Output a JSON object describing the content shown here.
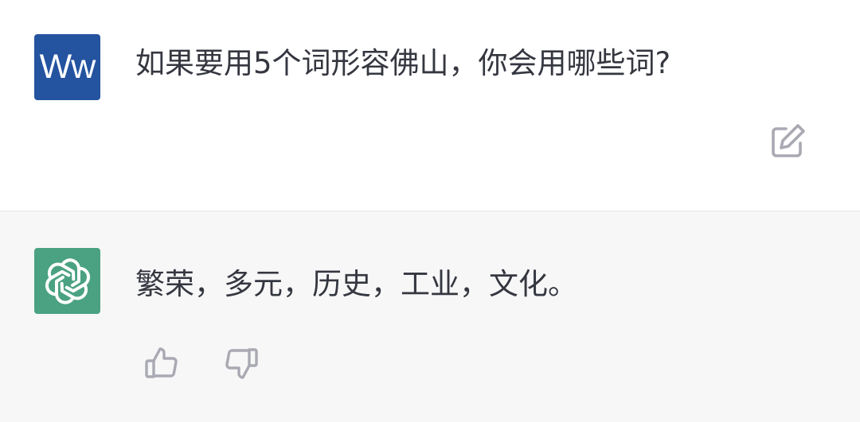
{
  "conversation": {
    "user": {
      "avatar_text": "Ww",
      "message": "如果要用5个词形容佛山，你会用哪些词?",
      "edit_icon": "edit-icon"
    },
    "assistant": {
      "avatar_icon": "openai-logo-icon",
      "message": "繁荣，多元，历史，工业，文化。",
      "feedback_icons": [
        "thumbs-up-icon",
        "thumbs-down-icon"
      ]
    }
  },
  "colors": {
    "user_avatar_bg": "#2453a0",
    "assistant_avatar_bg": "#4aa282",
    "assistant_row_bg": "#f7f7f8",
    "icon_gray": "#a9a9b3",
    "text": "#353740"
  }
}
